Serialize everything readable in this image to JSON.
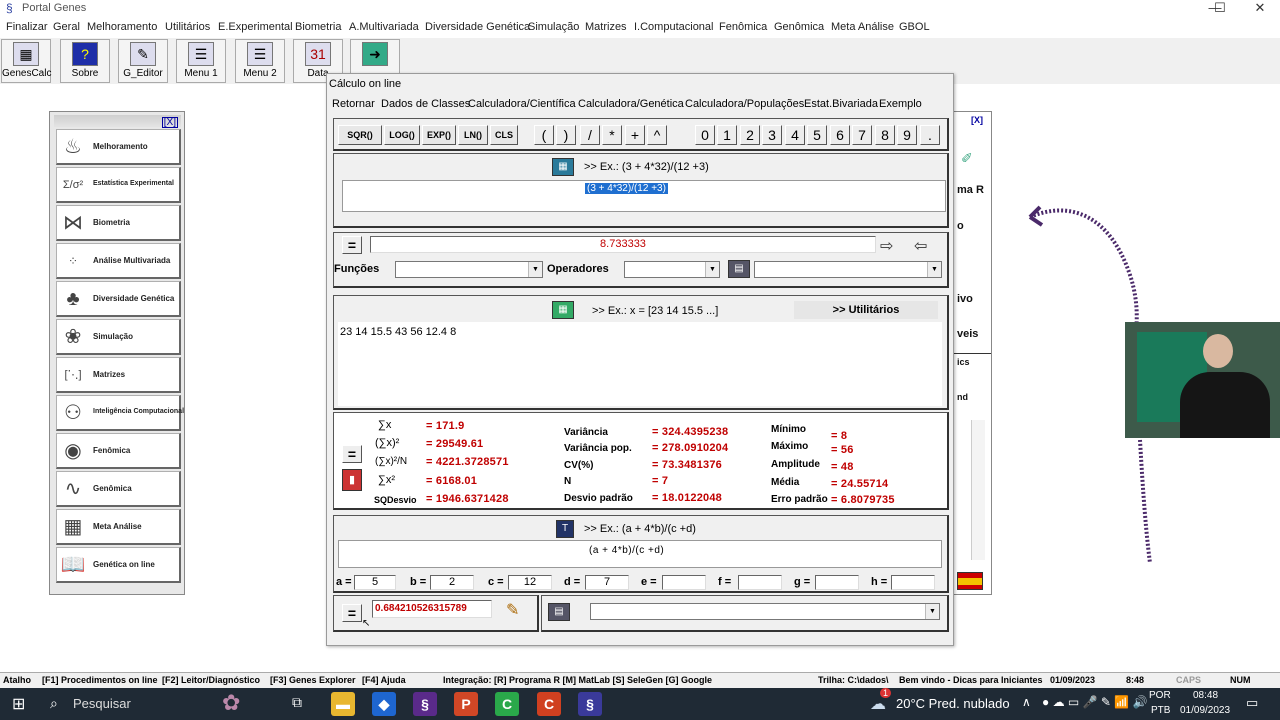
{
  "window": {
    "title": "Portal Genes"
  },
  "menubar": [
    "Finalizar",
    "Geral",
    "Melhoramento",
    "Utilitários",
    "E.Experimental",
    "Biometria",
    "A.Multivariada",
    "Diversidade Genética",
    "Simulação",
    "Matrizes",
    "I.Computacional",
    "Fenômica",
    "Genômica",
    "Meta Análise",
    "GBOL"
  ],
  "toolbar": [
    "GenesCalc",
    "Sobre",
    "G_Editor",
    "Menu 1",
    "Menu 2",
    "Data"
  ],
  "left_panel": {
    "close": "[X]",
    "items": [
      "Melhoramento",
      "Estatística Experimental",
      "Biometria",
      "Análise Multivariada",
      "Diversidade Genética",
      "Simulação",
      "Matrizes",
      "Inteligência Computacional",
      "Fenômica",
      "Genômica",
      "Meta Análise",
      "Genética on line"
    ]
  },
  "right_panel": {
    "close": "[X]",
    "labels": [
      "ma R",
      "o",
      "ivo",
      "veis",
      "ics",
      "nd"
    ]
  },
  "calc": {
    "title": "Cálculo on line",
    "menu": [
      "Retornar",
      "Dados de Classes",
      "Calculadora/Científica",
      "Calculadora/Genética",
      "Calculadora/Populações",
      "Estat.Bivariada",
      "Exemplo"
    ],
    "func_keys": [
      "SQR()",
      "LOG()",
      "EXP()",
      "LN()",
      "CLS"
    ],
    "op_keys": [
      "(",
      ")",
      "/",
      "*",
      "+",
      "^"
    ],
    "digits": [
      "0",
      "1",
      "2",
      "3",
      "4",
      "5",
      "6",
      "7",
      "8",
      "9",
      "."
    ],
    "expr_example": ">> Ex.: (3 + 4*32)/(12 +3)",
    "expr_value": "(3 + 4*32)/(12 +3)",
    "eq": "=",
    "result": "8.733333",
    "funcoes_label": "Funções",
    "operadores_label": "Operadores",
    "data_example": ">> Ex.: x = [23 14 15.5 ...]",
    "utilitarios": ">> Utilitários",
    "data_value": "23 14 15.5 43 56 12.4 8",
    "stats": {
      "sumx_label": "∑x",
      "sumx": "= 171.9",
      "sumx2sq_label": "(∑x)²",
      "sumx2sq": "= 29549.61",
      "sumx2n_label": "(∑x)²/N",
      "sumx2n": "= 4221.3728571",
      "sumsq_label": "∑x²",
      "sumsq": "= 6168.01",
      "sqdesvio_label": "SQDesvio",
      "sqdesvio": "= 1946.6371428",
      "variancia_label": "Variância",
      "variancia": "= 324.4395238",
      "varpop_label": "Variância pop.",
      "varpop": "= 278.0910204",
      "cv_label": "CV(%)",
      "cv": "= 73.3481376",
      "n_label": "N",
      "n": "= 7",
      "desvio_label": "Desvio padrão",
      "desvio": "= 18.0122048",
      "minimo_label": "Mínimo",
      "minimo": "= 8",
      "maximo_label": "Máximo",
      "maximo": "= 56",
      "amplitude_label": "Amplitude",
      "amplitude": "= 48",
      "media_label": "Média",
      "media": "= 24.55714",
      "erro_label": "Erro padrão",
      "erro": "= 6.8079735"
    },
    "formula_example": ">> Ex.: (a + 4*b)/(c +d)",
    "formula_value": "(a + 4*b)/(c +d)",
    "vars": [
      {
        "name": "a =",
        "value": "5"
      },
      {
        "name": "b =",
        "value": "2"
      },
      {
        "name": "c =",
        "value": "12"
      },
      {
        "name": "d =",
        "value": "7"
      },
      {
        "name": "e =",
        "value": ""
      },
      {
        "name": "f =",
        "value": ""
      },
      {
        "name": "g =",
        "value": ""
      },
      {
        "name": "h =",
        "value": ""
      }
    ],
    "formula_result": "0.684210526315789"
  },
  "statusbar": [
    "Atalho",
    "[F1] Procedimentos on line",
    "[F2] Leitor/Diagnóstico",
    "[F3] Genes Explorer",
    "[F4] Ajuda",
    "Integração: [R] Programa R [M] MatLab [S] SeleGen [G] Google",
    "Trilha: C:\\dados\\",
    "Bem vindo - Dicas para Iniciantes",
    "01/09/2023",
    "8:48",
    "CAPS",
    "NUM"
  ],
  "taskbar": {
    "search": "Pesquisar",
    "weather": "20°C  Pred. nublado",
    "lang1": "POR",
    "lang2": "PTB",
    "time": "08:48",
    "date": "01/09/2023",
    "badge": "1"
  },
  "colors": {
    "accent_red": "#c00000",
    "selection_blue": "#1f6fd0",
    "taskbar": "#1f2a35"
  }
}
